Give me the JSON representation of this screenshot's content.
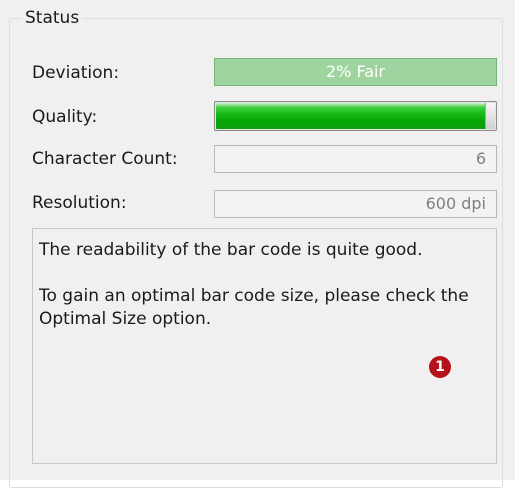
{
  "group": {
    "title": "Status"
  },
  "deviation": {
    "label": "Deviation:",
    "value": "2% Fair",
    "color": "#9fd39f"
  },
  "quality": {
    "label": "Quality:",
    "level": 0.97,
    "color": "#14b814"
  },
  "character_count": {
    "label": "Character Count:",
    "value": "6"
  },
  "resolution": {
    "label": "Resolution:",
    "value": "600 dpi"
  },
  "message": {
    "line1": "The readability of the bar code is quite good.",
    "line2": "To gain an optimal bar code size, please check the Optimal Size option."
  },
  "callout": {
    "label": "1",
    "color": "#b5131b"
  }
}
